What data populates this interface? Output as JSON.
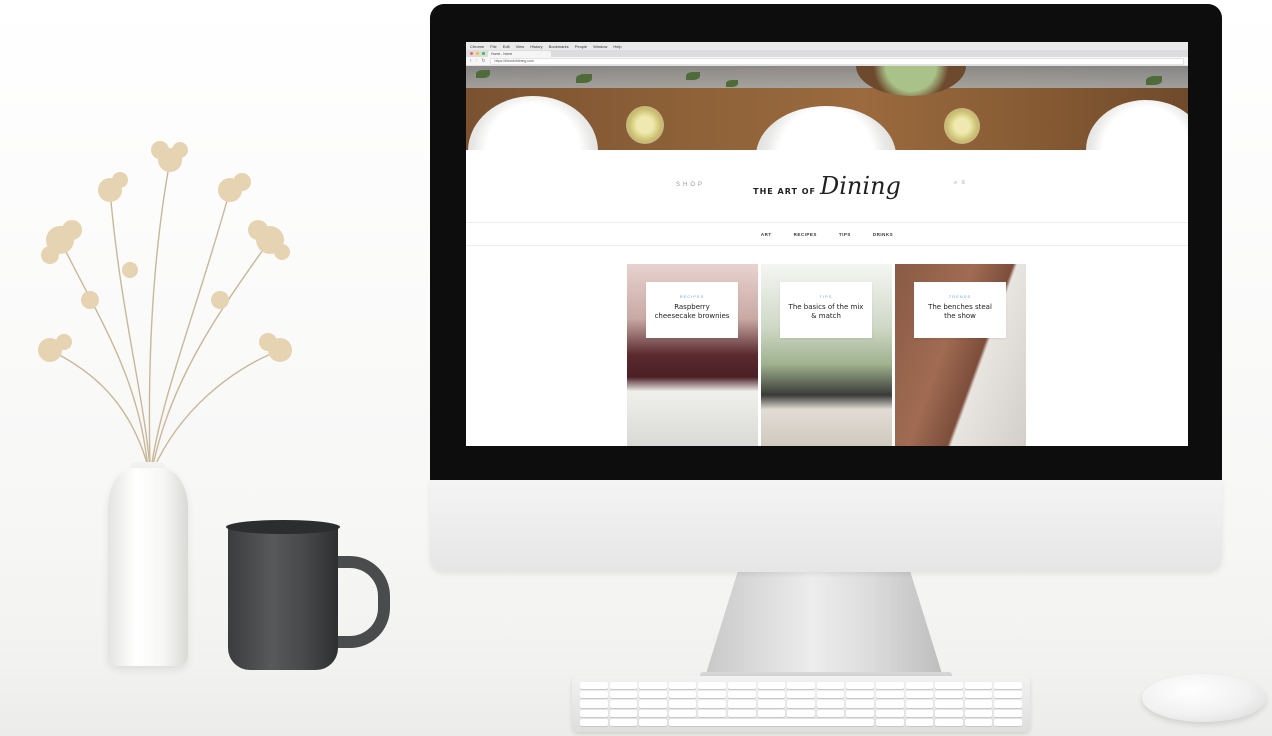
{
  "browser": {
    "app_menu": [
      "Chrome",
      "File",
      "Edit",
      "View",
      "History",
      "Bookmarks",
      "People",
      "Window",
      "Help"
    ],
    "tab_label": "Home - home",
    "url": "https://theartofdining.com"
  },
  "site": {
    "shop_label": "SHOP",
    "logo_prefix": "THE ART OF",
    "logo_script": "Dining",
    "nav": [
      "ART",
      "RECIPES",
      "TIPS",
      "DRINKS"
    ]
  },
  "posts": [
    {
      "category": "RECIPES",
      "title": "Raspberry cheesecake brownies"
    },
    {
      "category": "TIPS",
      "title": "The basics of the mix & match"
    },
    {
      "category": "TRENDS",
      "title": "The benches steal the show"
    }
  ],
  "colors": {
    "accent": "#6fa7c8",
    "bezel": "#0d0d0e"
  }
}
